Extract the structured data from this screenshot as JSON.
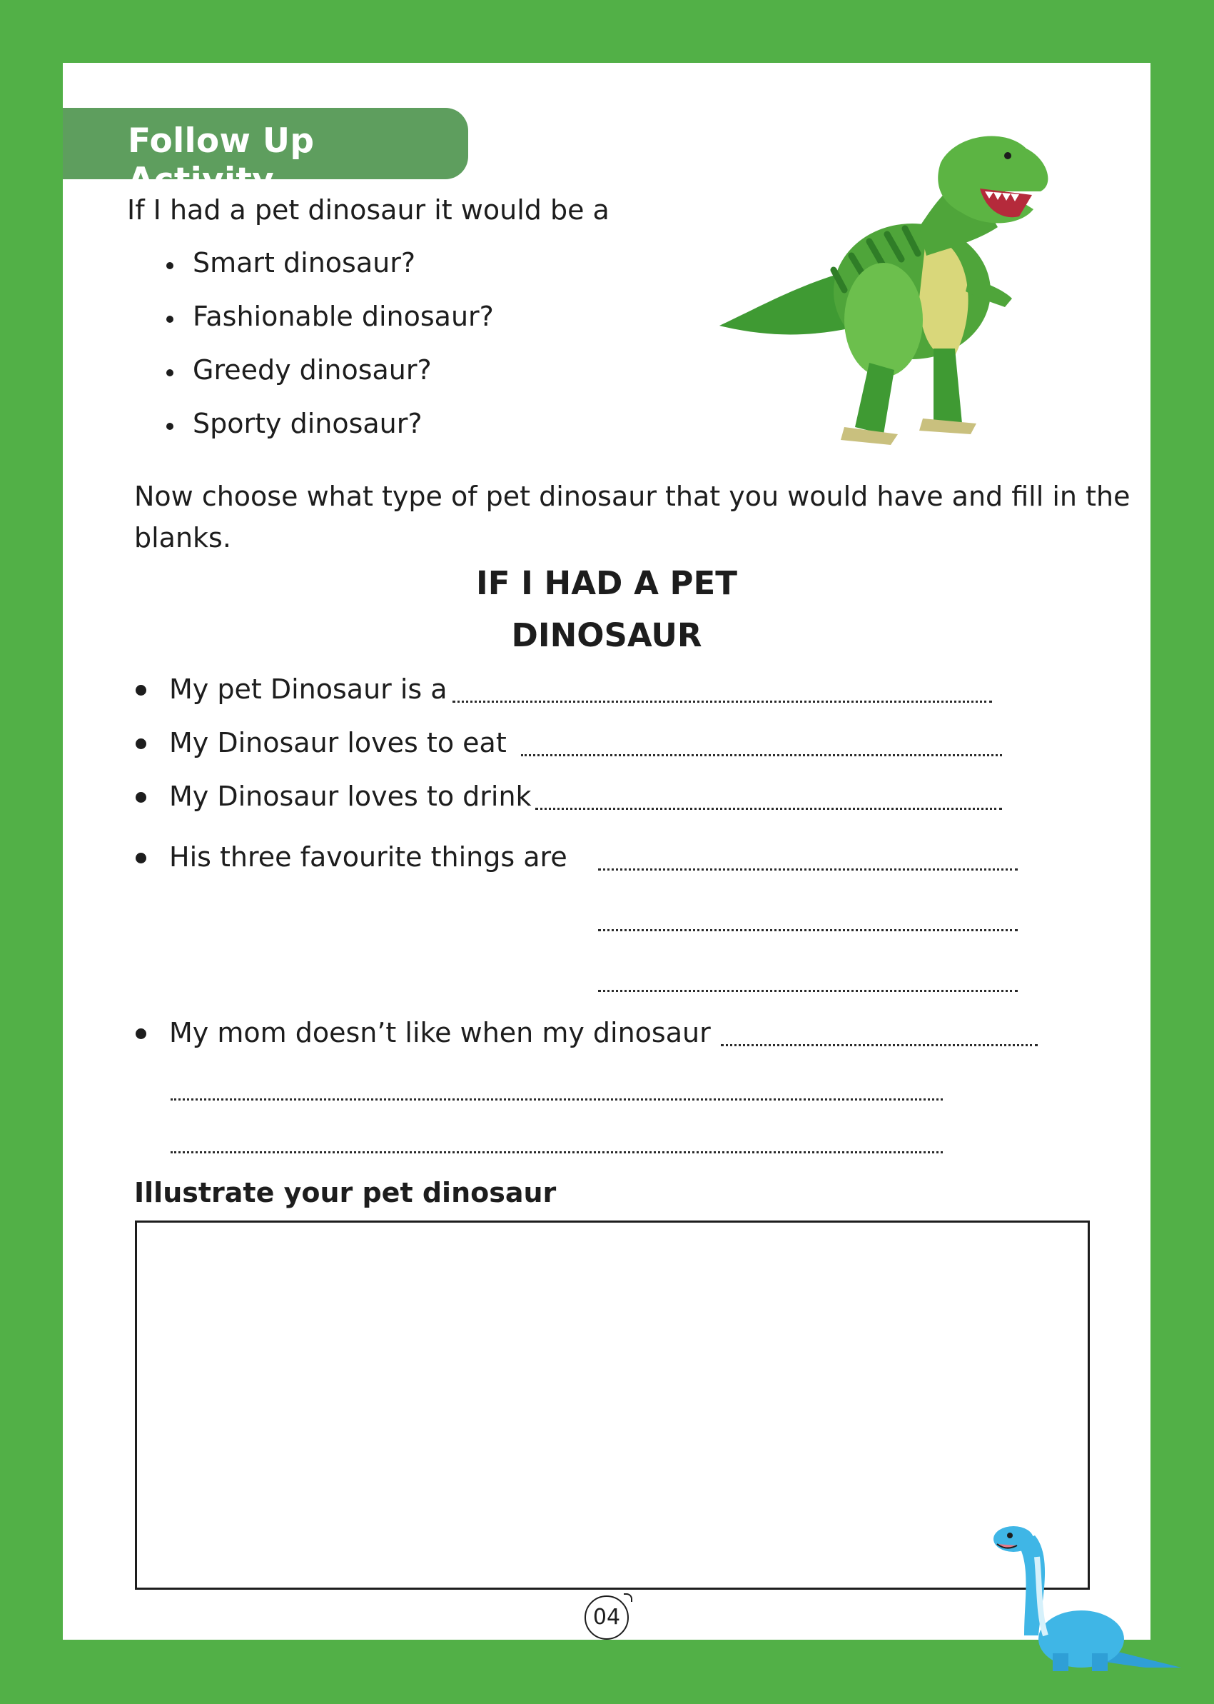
{
  "banner": {
    "title": "Follow Up Activity"
  },
  "intro": "If I had a pet dinosaur it would be a",
  "options": [
    "Smart dinosaur?",
    "Fashionable dinosaur?",
    "Greedy dinosaur?",
    "Sporty dinosaur?"
  ],
  "instruction": "Now choose what type of pet dinosaur that you would have and fill in the blanks.",
  "heading": {
    "line1": "IF I HAD A PET",
    "line2": "DINOSAUR"
  },
  "prompts": {
    "is_a": "My pet Dinosaur is a",
    "eat": "My Dinosaur loves to eat",
    "drink": "My Dinosaur loves to drink",
    "favourites": "His three favourite things are",
    "mom": "My mom doesn’t like when my dinosaur"
  },
  "illustrate_label": "Illustrate your pet dinosaur",
  "page_number": "04",
  "icons": {
    "trex": "t-rex-illustration",
    "brachio": "brachiosaurus-illustration"
  },
  "colors": {
    "border": "#52b047",
    "banner": "#5e9e5e",
    "trex": "#4fa53a",
    "brachio": "#3fb6e6"
  }
}
